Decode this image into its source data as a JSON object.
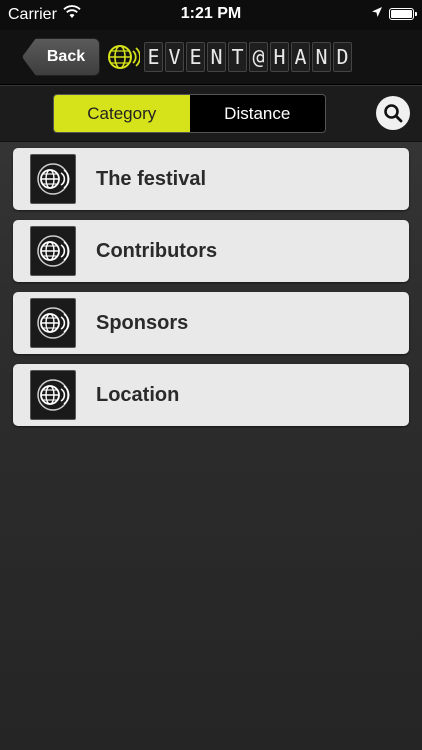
{
  "status_bar": {
    "carrier": "Carrier",
    "time": "1:21 PM",
    "icons": [
      "wifi-icon",
      "location-arrow-icon",
      "battery-icon"
    ]
  },
  "nav": {
    "back_label": "Back",
    "logo_letters": [
      "E",
      "V",
      "E",
      "N",
      "T",
      "@",
      "H",
      "A",
      "N",
      "D"
    ],
    "logo_icon": "globe-signal-icon",
    "accent_color": "#d6e21a"
  },
  "segments": {
    "items": [
      {
        "label": "Category",
        "active": true
      },
      {
        "label": "Distance",
        "active": false
      }
    ],
    "search_icon": "search-icon"
  },
  "list": {
    "items": [
      {
        "label": "The festival",
        "icon": "globe-signal-icon"
      },
      {
        "label": "Contributors",
        "icon": "globe-signal-icon"
      },
      {
        "label": "Sponsors",
        "icon": "globe-signal-icon"
      },
      {
        "label": "Location",
        "icon": "globe-signal-icon"
      }
    ]
  }
}
